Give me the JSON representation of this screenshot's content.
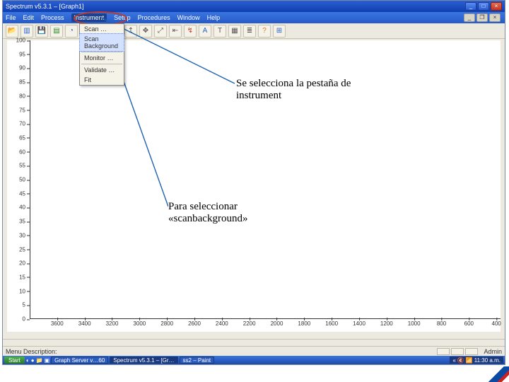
{
  "app": {
    "title": "Spectrum v5.3.1 – [Graph1]",
    "menus": [
      "File",
      "Edit",
      "Process",
      "Instrument",
      "Setup",
      "Procedures",
      "Window",
      "Help"
    ],
    "open_menu_index": 3,
    "dropdown": {
      "items": [
        "Scan …",
        "Scan Background",
        "Monitor …",
        "Validate …",
        "Fit"
      ],
      "highlighted_index": 1
    },
    "footer": {
      "left": "Menu Description:",
      "right": "Admin"
    }
  },
  "chart_data": {
    "type": "line",
    "title": "",
    "xlabel": "",
    "ylabel": "",
    "series": [],
    "y_ticks": [
      100.0,
      95,
      90,
      85,
      80,
      75,
      70,
      65,
      60,
      55,
      50,
      45,
      40,
      35,
      30,
      25,
      20,
      15,
      10,
      5,
      0.0
    ],
    "x_ticks": [
      3600,
      3400,
      3200,
      3000,
      2800,
      2600,
      2400,
      2200,
      2000,
      1800,
      1600,
      1400,
      1200,
      1000,
      800,
      600,
      400
    ],
    "xlim": [
      3800,
      370
    ],
    "ylim": [
      0,
      100
    ]
  },
  "taskbar": {
    "start": "Start",
    "ql": [
      "◐",
      "●",
      "📁",
      "▣"
    ],
    "items": [
      "Graph Server v…60",
      "Spectrum v5.3.1 – [Gr…",
      "ss2 – Paint"
    ],
    "active_index": 1,
    "tray": [
      "«",
      "🔇",
      "📶",
      "11:30 a.m."
    ]
  },
  "annotations": {
    "a1": "Se selecciona la pestaña de instrument",
    "a2": "Para seleccionar «scanbackground»"
  },
  "toolbar_icons": [
    {
      "name": "open-folder-icon",
      "glyph": "📂",
      "cls": "y"
    },
    {
      "name": "book-icon",
      "glyph": "▥",
      "cls": "b"
    },
    {
      "name": "save-icon",
      "glyph": "💾",
      "cls": "b"
    },
    {
      "name": "graph-icon",
      "glyph": "▤",
      "cls": "g"
    },
    {
      "name": "scan-icon",
      "glyph": "◔",
      "cls": "b"
    },
    {
      "name": "rescan-icon",
      "glyph": "◕",
      "cls": "b"
    },
    {
      "name": "stop-icon",
      "glyph": "■",
      "cls": "r"
    },
    {
      "name": "play-icon",
      "glyph": "▶",
      "cls": "g"
    },
    {
      "name": "pointer-up-icon",
      "glyph": "↥",
      "cls": ""
    },
    {
      "name": "pan-icon",
      "glyph": "✥",
      "cls": ""
    },
    {
      "name": "zoom-auto-icon",
      "glyph": "⤢",
      "cls": ""
    },
    {
      "name": "zoom-prev-icon",
      "glyph": "⇤",
      "cls": ""
    },
    {
      "name": "xy-axis-icon",
      "glyph": "↯",
      "cls": "r"
    },
    {
      "name": "text-a-icon",
      "glyph": "A",
      "cls": "b"
    },
    {
      "name": "label-t-icon",
      "glyph": "T",
      "cls": ""
    },
    {
      "name": "grid-icon",
      "glyph": "▦",
      "cls": ""
    },
    {
      "name": "list-icon",
      "glyph": "≣",
      "cls": ""
    },
    {
      "name": "help-icon",
      "glyph": "?",
      "cls": "o"
    },
    {
      "name": "window-icon",
      "glyph": "⊞",
      "cls": "b"
    }
  ]
}
